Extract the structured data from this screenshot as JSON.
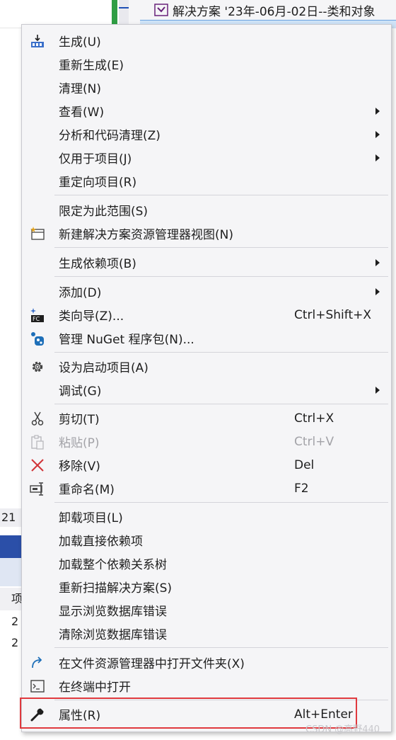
{
  "background": {
    "solution_label": "解决方案 '23年-06月-02日--类和对象",
    "left_number": "21",
    "left_header": "项",
    "left_cell_1": "2",
    "left_cell_2": "2"
  },
  "menu": {
    "items": [
      {
        "label": "生成(U)",
        "shortcut": "",
        "submenu": false,
        "icon": "build-icon",
        "disabled": false
      },
      {
        "label": "重新生成(E)",
        "shortcut": "",
        "submenu": false,
        "icon": "",
        "disabled": false
      },
      {
        "label": "清理(N)",
        "shortcut": "",
        "submenu": false,
        "icon": "",
        "disabled": false
      },
      {
        "label": "查看(W)",
        "shortcut": "",
        "submenu": true,
        "icon": "",
        "disabled": false
      },
      {
        "label": "分析和代码清理(Z)",
        "shortcut": "",
        "submenu": true,
        "icon": "",
        "disabled": false
      },
      {
        "label": "仅用于项目(J)",
        "shortcut": "",
        "submenu": true,
        "icon": "",
        "disabled": false
      },
      {
        "label": "重定向项目(R)",
        "shortcut": "",
        "submenu": false,
        "icon": "",
        "disabled": false
      },
      {
        "label": "限定为此范围(S)",
        "shortcut": "",
        "submenu": false,
        "icon": "",
        "disabled": false
      },
      {
        "label": "新建解决方案资源管理器视图(N)",
        "shortcut": "",
        "submenu": false,
        "icon": "new-view-icon",
        "disabled": false
      },
      {
        "label": "生成依赖项(B)",
        "shortcut": "",
        "submenu": true,
        "icon": "",
        "disabled": false
      },
      {
        "label": "添加(D)",
        "shortcut": "",
        "submenu": true,
        "icon": "",
        "disabled": false
      },
      {
        "label": "类向导(Z)...",
        "shortcut": "Ctrl+Shift+X",
        "submenu": false,
        "icon": "class-wizard-icon",
        "disabled": false
      },
      {
        "label": "管理 NuGet 程序包(N)...",
        "shortcut": "",
        "submenu": false,
        "icon": "nuget-icon",
        "disabled": false
      },
      {
        "label": "设为启动项目(A)",
        "shortcut": "",
        "submenu": false,
        "icon": "gear-icon",
        "disabled": false
      },
      {
        "label": "调试(G)",
        "shortcut": "",
        "submenu": true,
        "icon": "",
        "disabled": false
      },
      {
        "label": "剪切(T)",
        "shortcut": "Ctrl+X",
        "submenu": false,
        "icon": "scissors-icon",
        "disabled": false
      },
      {
        "label": "粘贴(P)",
        "shortcut": "Ctrl+V",
        "submenu": false,
        "icon": "paste-icon",
        "disabled": true
      },
      {
        "label": "移除(V)",
        "shortcut": "Del",
        "submenu": false,
        "icon": "remove-icon",
        "disabled": false
      },
      {
        "label": "重命名(M)",
        "shortcut": "F2",
        "submenu": false,
        "icon": "rename-icon",
        "disabled": false
      },
      {
        "label": "卸载项目(L)",
        "shortcut": "",
        "submenu": false,
        "icon": "",
        "disabled": false
      },
      {
        "label": "加载直接依赖项",
        "shortcut": "",
        "submenu": false,
        "icon": "",
        "disabled": false
      },
      {
        "label": "加载整个依赖关系树",
        "shortcut": "",
        "submenu": false,
        "icon": "",
        "disabled": false
      },
      {
        "label": "重新扫描解决方案(S)",
        "shortcut": "",
        "submenu": false,
        "icon": "",
        "disabled": false
      },
      {
        "label": "显示浏览数据库错误",
        "shortcut": "",
        "submenu": false,
        "icon": "",
        "disabled": false
      },
      {
        "label": "清除浏览数据库错误",
        "shortcut": "",
        "submenu": false,
        "icon": "",
        "disabled": false
      },
      {
        "label": "在文件资源管理器中打开文件夹(X)",
        "shortcut": "",
        "submenu": false,
        "icon": "open-folder-icon",
        "disabled": false
      },
      {
        "label": "在终端中打开",
        "shortcut": "",
        "submenu": false,
        "icon": "terminal-icon",
        "disabled": false
      },
      {
        "label": "属性(R)",
        "shortcut": "Alt+Enter",
        "submenu": false,
        "icon": "wrench-icon",
        "disabled": false
      }
    ]
  },
  "highlight": {
    "target": "属性(R)",
    "color": "#e0393e"
  },
  "watermark": "CSDN @高野440"
}
